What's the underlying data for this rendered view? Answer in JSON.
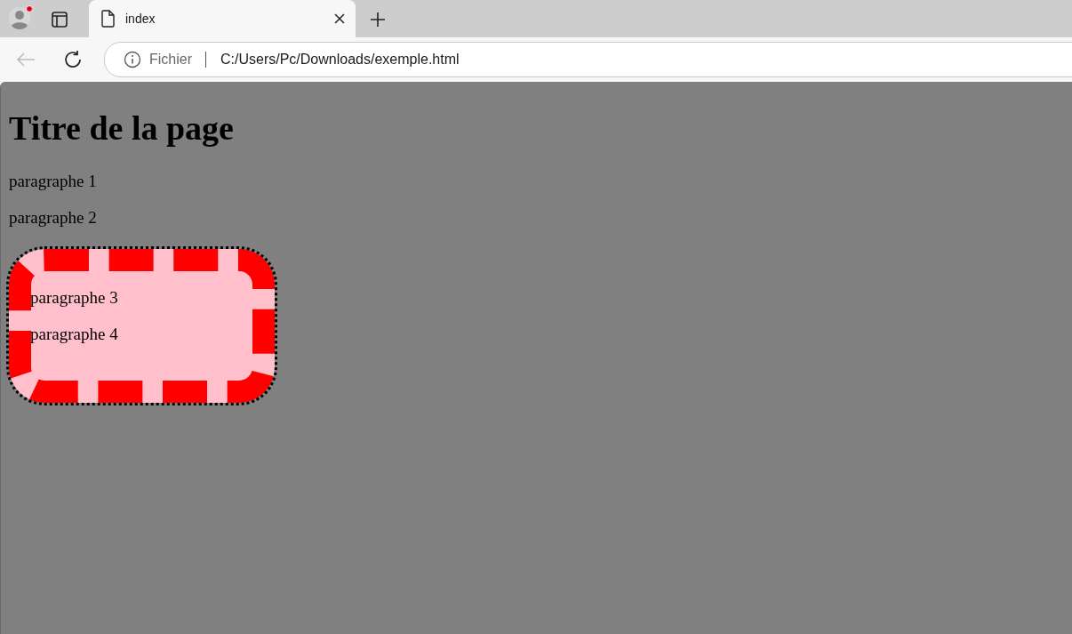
{
  "tabs": [
    {
      "title": "index",
      "selected": true
    }
  ],
  "toolbar": {
    "back_enabled": false
  },
  "address_bar": {
    "scheme_label": "Fichier",
    "url": "C:/Users/Pc/Downloads/exemple.html"
  },
  "page": {
    "heading": "Titre de la page",
    "paragraphs": [
      "paragraphe 1",
      "paragraphe 2"
    ],
    "framed_box": {
      "paragraphs": [
        "paragraphe 3",
        "paragraphe 4"
      ]
    }
  }
}
